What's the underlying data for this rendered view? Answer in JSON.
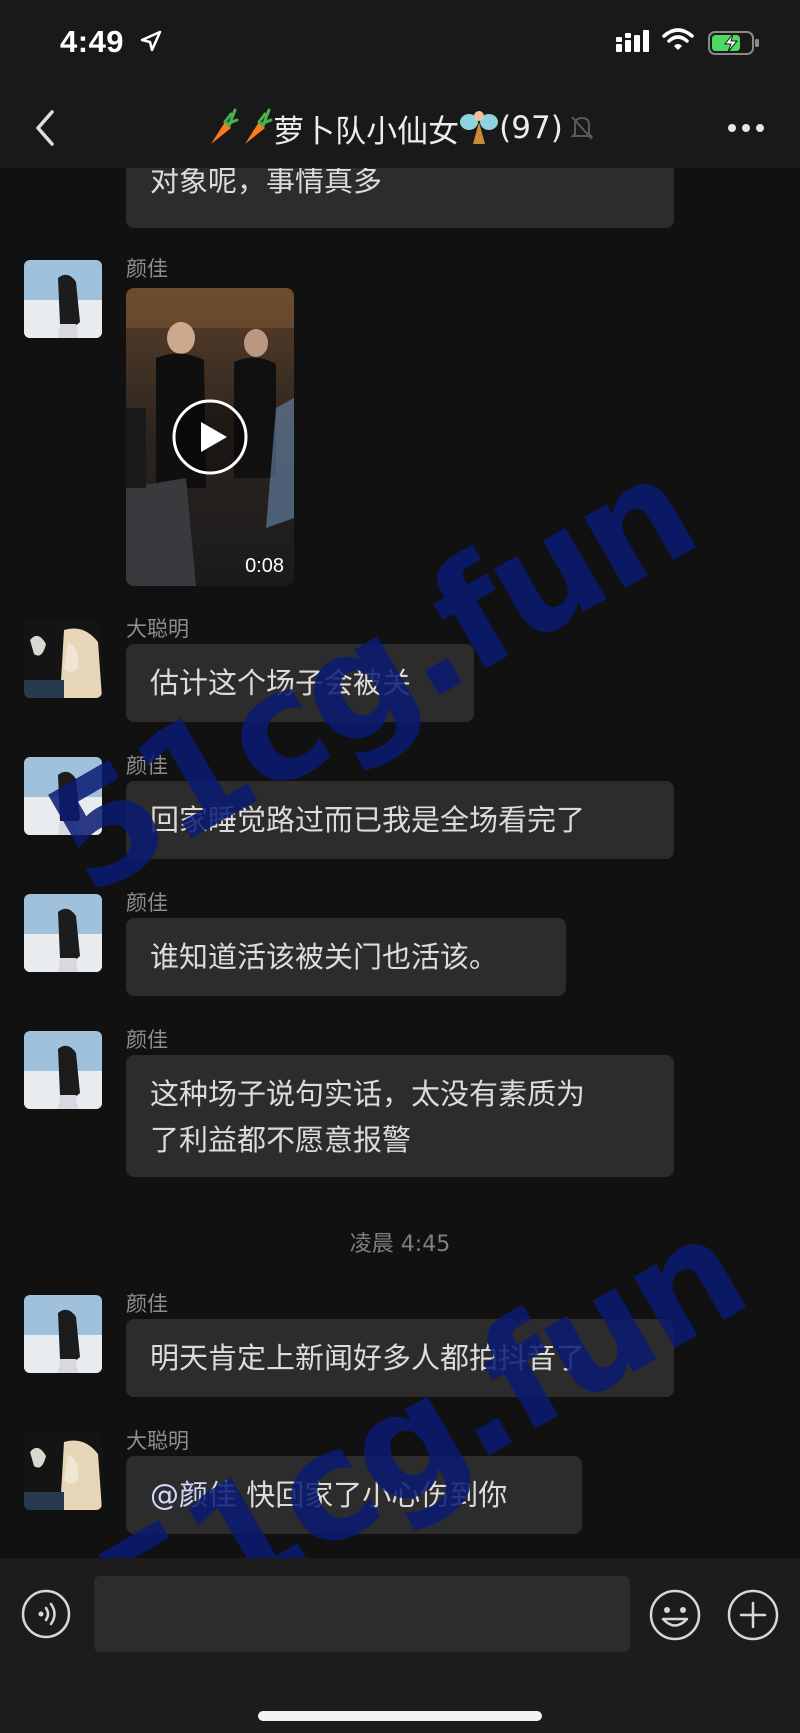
{
  "status_bar": {
    "time": "4:49"
  },
  "header": {
    "title": "萝卜队小仙女",
    "member_count": "(97)"
  },
  "messages": [
    {
      "text": "对象呢，事情真多"
    },
    {
      "sender": "颜佳",
      "video_duration": "0:08"
    },
    {
      "sender": "大聪明",
      "text": "估计这个场子会被关"
    },
    {
      "sender": "颜佳",
      "text": "回家睡觉路过而已我是全场看完了"
    },
    {
      "sender": "颜佳",
      "text": "谁知道活该被关门也活该。"
    },
    {
      "sender": "颜佳",
      "text_line1": "这种场子说句实话，太没有素质为",
      "text_line2": "了利益都不愿意报警"
    },
    {
      "timestamp": "凌晨 4:45"
    },
    {
      "sender": "颜佳",
      "text": "明天肯定上新闻好多人都拍抖音了"
    },
    {
      "sender": "大聪明",
      "mention": "@颜佳",
      "text": " 快回家了小心伤到你"
    }
  ],
  "watermark": "51cg.fun",
  "input_bar": {
    "placeholder": ""
  },
  "icons": [
    "back-icon",
    "carrot-icon",
    "fairy-icon",
    "mute-bell-icon",
    "more-icon",
    "voice-icon",
    "emoji-icon",
    "plus-icon",
    "play-icon",
    "signal-icon",
    "wifi-icon",
    "battery-icon",
    "location-arrow-icon"
  ]
}
